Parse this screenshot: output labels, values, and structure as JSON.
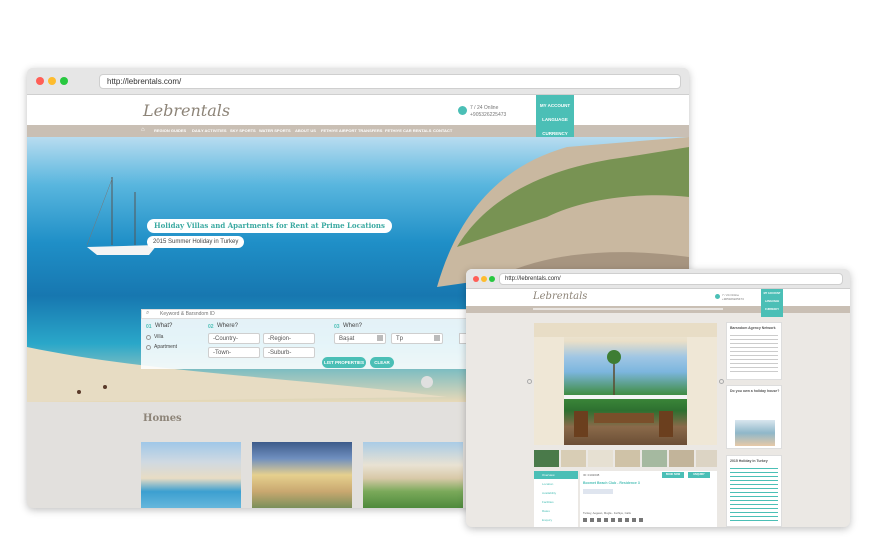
{
  "window1": {
    "url": "http://lebrentals.com/",
    "logo": "Lebrentals",
    "contact": {
      "hours": "7 / 24 Online",
      "phone": "+905326225473"
    },
    "side_menu": [
      "MY ACCOUNT",
      "LANGUAGE",
      "CURRENCY"
    ],
    "nav": [
      "REGION GUIDES",
      "DAILY ACTIVITIES",
      "SKY SPORTS",
      "WATER SPORTS",
      "ABOUT US",
      "FETHIYE AIRPORT TRANSFERS",
      "FETHIYE CAR RENTALS",
      "CONTACT"
    ],
    "hero": {
      "headline": "Holiday Villas and Apartments for Rent at Prime Locations",
      "subline": "2015 Summer Holiday in Turkey"
    },
    "search": {
      "keyword_placeholder": "Keyword & Barsndom ID",
      "what": {
        "num": "01",
        "label": "What?",
        "options": [
          "Villa",
          "Apartment"
        ]
      },
      "where": {
        "num": "02",
        "label": "Where?",
        "country": "-Country-",
        "region": "-Region-",
        "town": "-Town-",
        "suburb": "-Suburb-"
      },
      "when": {
        "num": "03",
        "label": "When?",
        "from": "Başat",
        "to": "Tp"
      },
      "list_button": "LIST PROPERTIES",
      "clear_button": "CLEAR"
    },
    "homes_title": "Homes"
  },
  "window2": {
    "url": "http://lebrentals.com/",
    "logo": "Lebrentals",
    "contact": {
      "hours": "7 / 24 Online",
      "phone": "+905326225473"
    },
    "side_menu": [
      "MY ACCOUNT",
      "LANGUAGE",
      "CURRENCY"
    ],
    "tabs": [
      "Overview",
      "Location",
      "Availability",
      "Facilities",
      "Rates",
      "Enquiry"
    ],
    "property_title": "Boomet Beach Club - Residence 3",
    "property_id": "ID: 0102038",
    "address": "Turkey, Aegean, Mugla - Fethiye, Calis",
    "book_now": "BOOK NOW",
    "enquiry": "ENQUIRY",
    "sidebar": [
      {
        "title": "Barsndom Agency Network"
      },
      {
        "title": "Do you own a holiday house?"
      },
      {
        "title": "2015 Holiday in Turkey"
      }
    ]
  },
  "colors": {
    "accent": "#4bbfb6",
    "nav": "#c9bfb4",
    "logo": "#8d8478"
  }
}
